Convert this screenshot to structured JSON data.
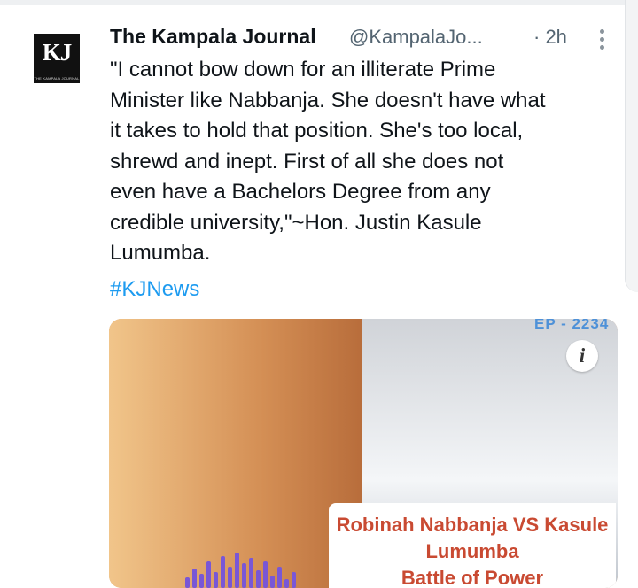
{
  "tweet": {
    "author_name": "The Kampala Journal",
    "handle": "@KampalaJo...",
    "time": "· 2h",
    "text": "\"I cannot bow down for an illiterate Prime\nMinister like Nabbanja. She doesn't have what\nit takes to hold that position. She's too local,\nshrewd and inept. First of all she does not\neven have a Bachelors Degree from any\ncredible university,\"~Hon. Justin Kasule\nLumumba.",
    "hashtag": "#KJNews"
  },
  "avatar": {
    "logo_text": "KJ",
    "logo_small": "THE KAMPALA JOURNAL"
  },
  "media": {
    "caption_line1": "Robinah Nabbanja VS Kasule",
    "caption_line2": "Lumumba",
    "caption_line3": "Battle of Power",
    "corner_tag": "EP - 2234",
    "info_icon": "i"
  },
  "colors": {
    "text": "#0f1419",
    "muted": "#536471",
    "link": "#1d9bf0",
    "caption": "#c94a32"
  }
}
